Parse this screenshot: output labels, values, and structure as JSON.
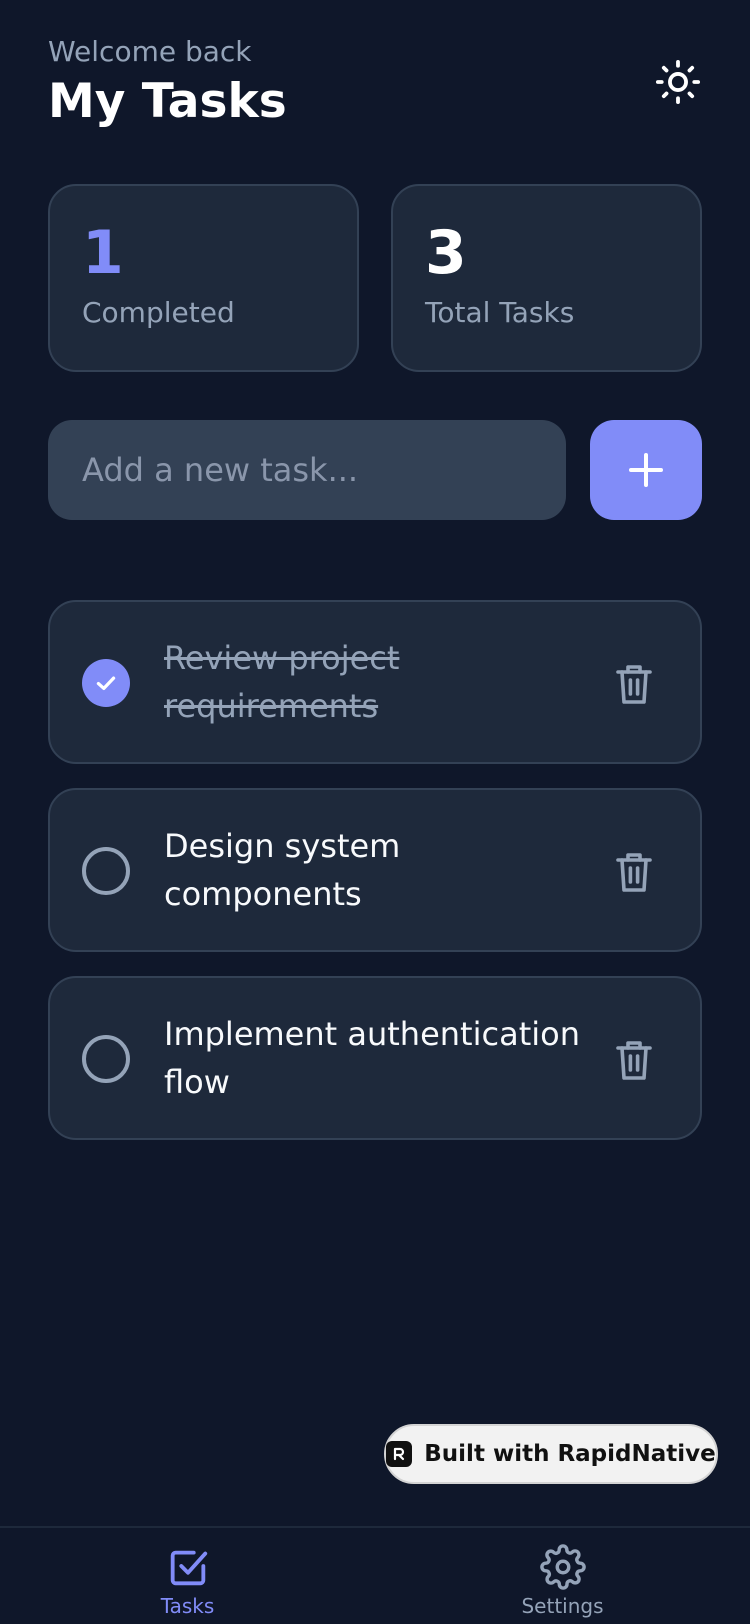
{
  "header": {
    "welcome": "Welcome back",
    "title": "My Tasks",
    "theme_icon": "sun-icon"
  },
  "stats": {
    "completed": {
      "value": "1",
      "label": "Completed"
    },
    "total": {
      "value": "3",
      "label": "Total Tasks"
    }
  },
  "add_task": {
    "placeholder": "Add a new task...",
    "value": "",
    "button_icon": "plus-icon"
  },
  "tasks": [
    {
      "text": "Review project requirements",
      "completed": true
    },
    {
      "text": "Design system components",
      "completed": false
    },
    {
      "text": "Implement authentication flow",
      "completed": false
    }
  ],
  "badge": {
    "text": "Built with RapidNative"
  },
  "tabbar": {
    "items": [
      {
        "label": "Tasks",
        "icon": "checkbox-icon",
        "active": true
      },
      {
        "label": "Settings",
        "icon": "gear-icon",
        "active": false
      }
    ]
  },
  "colors": {
    "background": "#0f172a",
    "card": "#1e293b",
    "accent": "#818cf8",
    "muted": "#94a3b8"
  }
}
